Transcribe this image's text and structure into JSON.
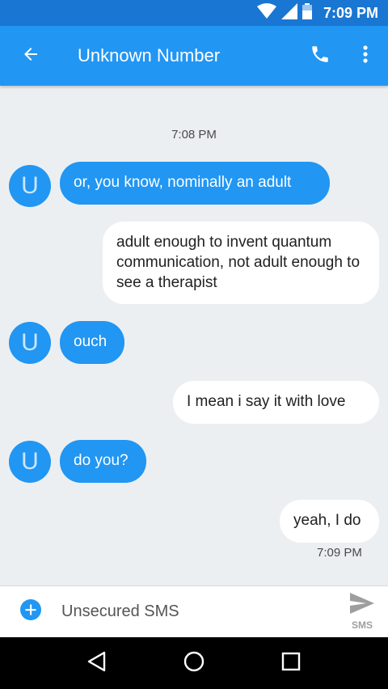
{
  "status_bar": {
    "time": "7:09 PM"
  },
  "toolbar": {
    "title": "Unknown Number"
  },
  "conversation": {
    "timestamp_top": "7:08 PM",
    "timestamp_bottom": "7:09 PM",
    "avatar_letter": "U",
    "messages": [
      {
        "direction": "incoming",
        "text": "or, you know, nominally an adult"
      },
      {
        "direction": "outgoing",
        "text": "adult enough to invent quantum communication, not adult enough to see a therapist"
      },
      {
        "direction": "incoming",
        "text": "ouch"
      },
      {
        "direction": "outgoing",
        "text": "I mean i say it with love"
      },
      {
        "direction": "incoming",
        "text": "do you?"
      },
      {
        "direction": "outgoing",
        "text": "yeah, I do"
      }
    ]
  },
  "compose": {
    "placeholder": "Unsecured SMS",
    "send_label": "SMS"
  },
  "colors": {
    "status_bar": "#1976d2",
    "toolbar": "#2196f3",
    "incoming_bubble": "#2196f3",
    "background": "#eceff1"
  },
  "icons": [
    "wifi-icon",
    "signal-icon",
    "battery-icon",
    "back-arrow-icon",
    "phone-icon",
    "overflow-menu-icon",
    "add-attachment-icon",
    "send-icon",
    "nav-back-icon",
    "nav-home-icon",
    "nav-recents-icon"
  ]
}
